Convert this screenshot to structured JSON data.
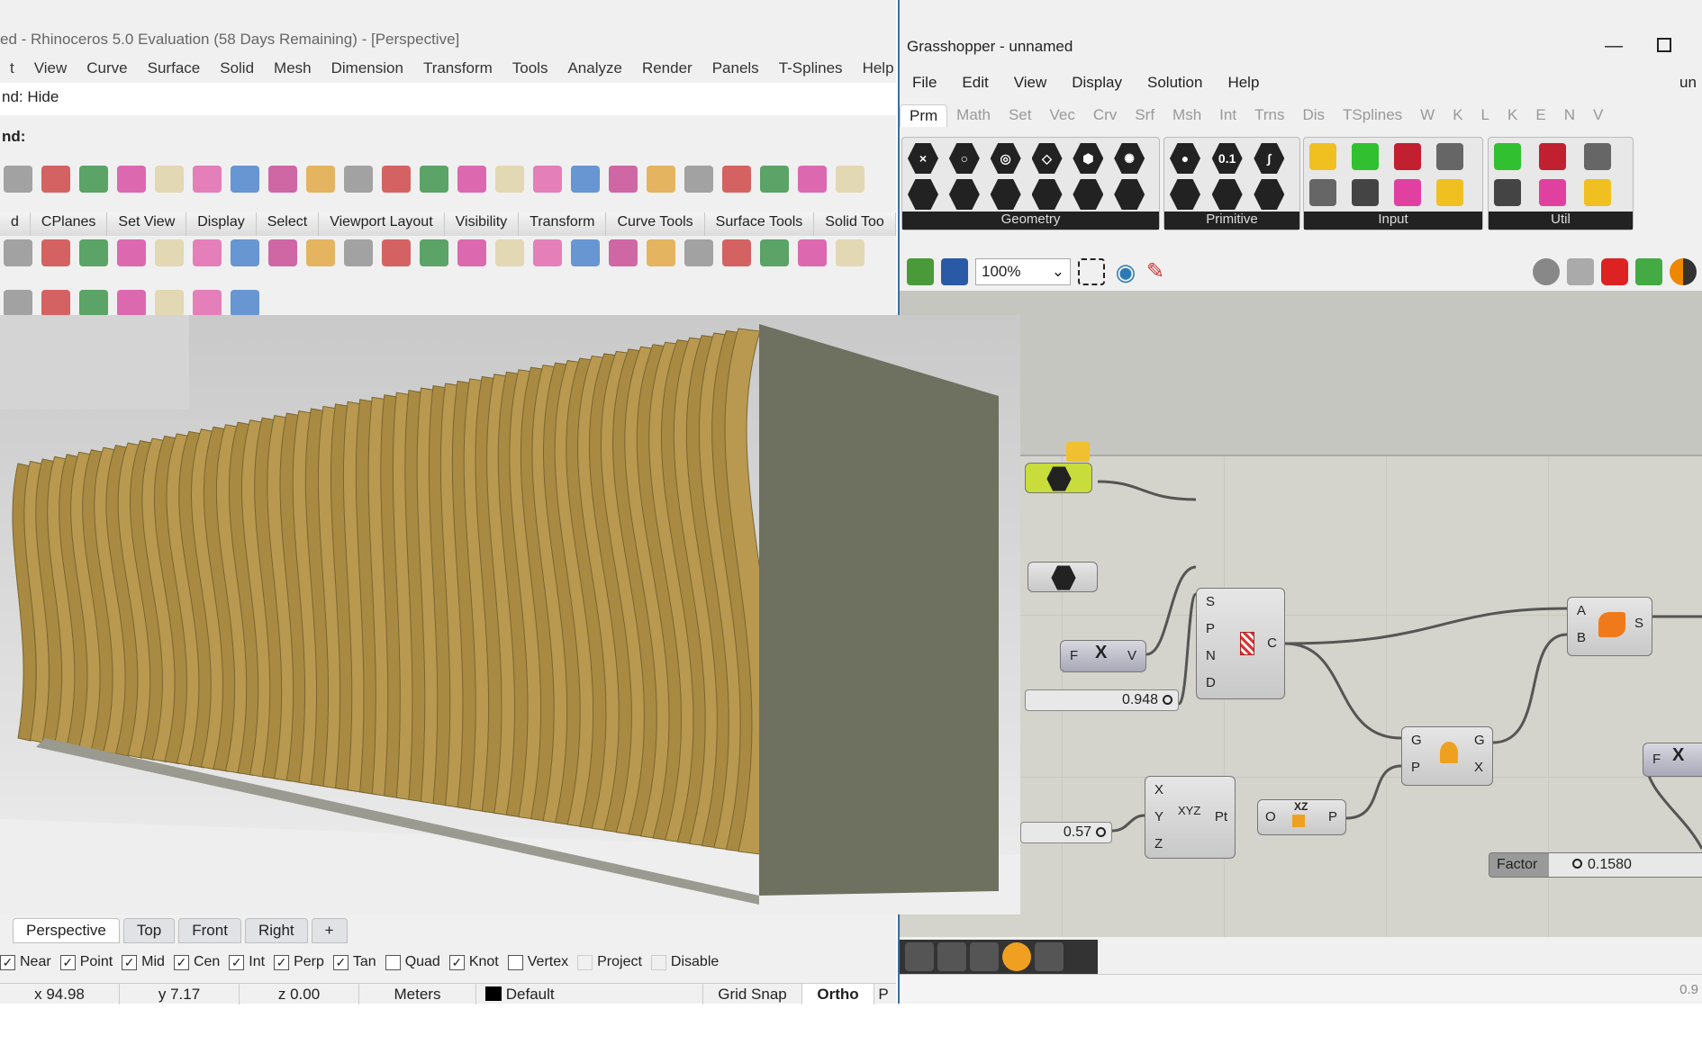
{
  "rhino": {
    "title": "ed - Rhinoceros 5.0 Evaluation (58 Days Remaining) - [Perspective]",
    "menu": [
      "t",
      "View",
      "Curve",
      "Surface",
      "Solid",
      "Mesh",
      "Dimension",
      "Transform",
      "Tools",
      "Analyze",
      "Render",
      "Panels",
      "T-Splines",
      "Help"
    ],
    "command_history": "nd: Hide",
    "command_prompt": "nd:",
    "toolbar_tabs": [
      "d",
      "CPlanes",
      "Set View",
      "Display",
      "Select",
      "Viewport Layout",
      "Visibility",
      "Transform",
      "Curve Tools",
      "Surface Tools",
      "Solid Too"
    ],
    "viewport_tabs": [
      "Perspective",
      "Top",
      "Front",
      "Right",
      "+"
    ],
    "osnaps": [
      {
        "label": "Near",
        "checked": true
      },
      {
        "label": "Point",
        "checked": true
      },
      {
        "label": "Mid",
        "checked": true
      },
      {
        "label": "Cen",
        "checked": true
      },
      {
        "label": "Int",
        "checked": true
      },
      {
        "label": "Perp",
        "checked": true
      },
      {
        "label": "Tan",
        "checked": true
      },
      {
        "label": "Quad",
        "checked": false
      },
      {
        "label": "Knot",
        "checked": true
      },
      {
        "label": "Vertex",
        "checked": false
      },
      {
        "label": "Project",
        "checked": false,
        "disabled": true
      },
      {
        "label": "Disable",
        "checked": false,
        "disabled": true
      }
    ],
    "status": {
      "x": "x 94.98",
      "y": "y 7.17",
      "z": "z 0.00",
      "units": "Meters",
      "layer": "Default",
      "grid_snap": "Grid Snap",
      "ortho": "Ortho",
      "planar": "P"
    }
  },
  "grasshopper": {
    "title": "Grasshopper - unnamed",
    "menu": [
      "File",
      "Edit",
      "View",
      "Display",
      "Solution",
      "Help"
    ],
    "doc_name": "un",
    "tabs": [
      "Prm",
      "Math",
      "Set",
      "Vec",
      "Crv",
      "Srf",
      "Msh",
      "Int",
      "Trns",
      "Dis",
      "TSplines",
      "W",
      "K",
      "L",
      "K",
      "E",
      "N",
      "V"
    ],
    "ribbon_groups": [
      "Geometry",
      "Primitive",
      "Input",
      "Util"
    ],
    "zoom": "100%",
    "components": {
      "curve_comp": {
        "inputs": [
          "S",
          "P",
          "N",
          "D"
        ],
        "output": "C"
      },
      "expr": {
        "input": "F",
        "symbol": "X",
        "output": "V"
      },
      "construct_point": {
        "inputs": [
          "X",
          "Y",
          "Z"
        ],
        "symbol": "XYZ",
        "output": "Pt"
      },
      "plane": {
        "input": "O",
        "symbol": "XZ",
        "output": "P"
      },
      "orient": {
        "inputs": [
          "G",
          "P"
        ],
        "outputs": [
          "G",
          "X"
        ]
      },
      "surface": {
        "inputs": [
          "A",
          "B"
        ],
        "output": "S"
      },
      "expr2": {
        "input": "F",
        "symbol": "X"
      }
    },
    "sliders": {
      "s1": "0.948",
      "s2": "0.57",
      "factor_label": "Factor",
      "factor_value": "0.1580"
    },
    "status_right": "0.9"
  },
  "colors": {
    "accent": "#3a6ea5",
    "fin": "#b8994f",
    "wall": "#6e7060",
    "canvas": "#d4d4cc",
    "selected": "#c8dc3c"
  }
}
